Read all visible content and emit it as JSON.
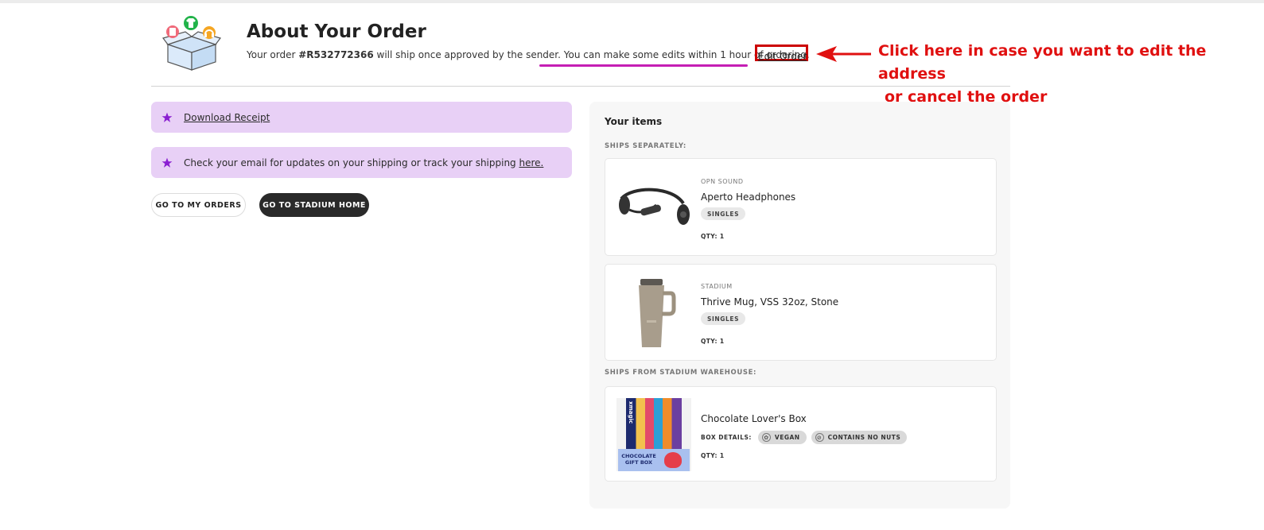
{
  "header": {
    "title": "About Your Order",
    "subtitle_prefix": "Your order ",
    "order_number": "#R532772366",
    "subtitle_mid": " will ship once approved by the sender. ",
    "subtitle_edit_note": "You can make some edits within 1 hour of ordering.",
    "edit_link": "Edit Order"
  },
  "annotation": {
    "line1": "Click here in case you want to edit the address",
    "line2": "or cancel the order",
    "color": "#e01010"
  },
  "notices": {
    "download_receipt": "Download Receipt",
    "shipping_text": "Check your email for updates on your shipping or track your shipping ",
    "shipping_link": "here."
  },
  "buttons": {
    "my_orders": "GO TO MY ORDERS",
    "stadium_home": "GO TO STADIUM HOME"
  },
  "items_panel": {
    "title": "Your items",
    "section_separately": "SHIPS SEPARATELY:",
    "section_warehouse": "SHIPS FROM STADIUM WAREHOUSE:",
    "items": [
      {
        "brand": "OPN SOUND",
        "name": "Aperto Headphones",
        "tag": "SINGLES",
        "qty": "QTY: 1"
      },
      {
        "brand": "STADIUM",
        "name": "Thrive Mug, VSS 32oz, Stone",
        "tag": "SINGLES",
        "qty": "QTY: 1"
      },
      {
        "name": "Chocolate Lover's Box",
        "box_details_label": "BOX DETAILS:",
        "tags": [
          "VEGAN",
          "CONTAINS NO NUTS"
        ],
        "qty": "QTY: 1",
        "thumb_brand": "xmagic",
        "thumb_caption": "CHOCOLATE GIFT BOX"
      }
    ]
  },
  "colors": {
    "accent_purple": "#8a1fd1",
    "notice_bg": "#e8d0f6",
    "highlight_underline": "#c51eb4",
    "dark_button": "#2a2a2a"
  }
}
